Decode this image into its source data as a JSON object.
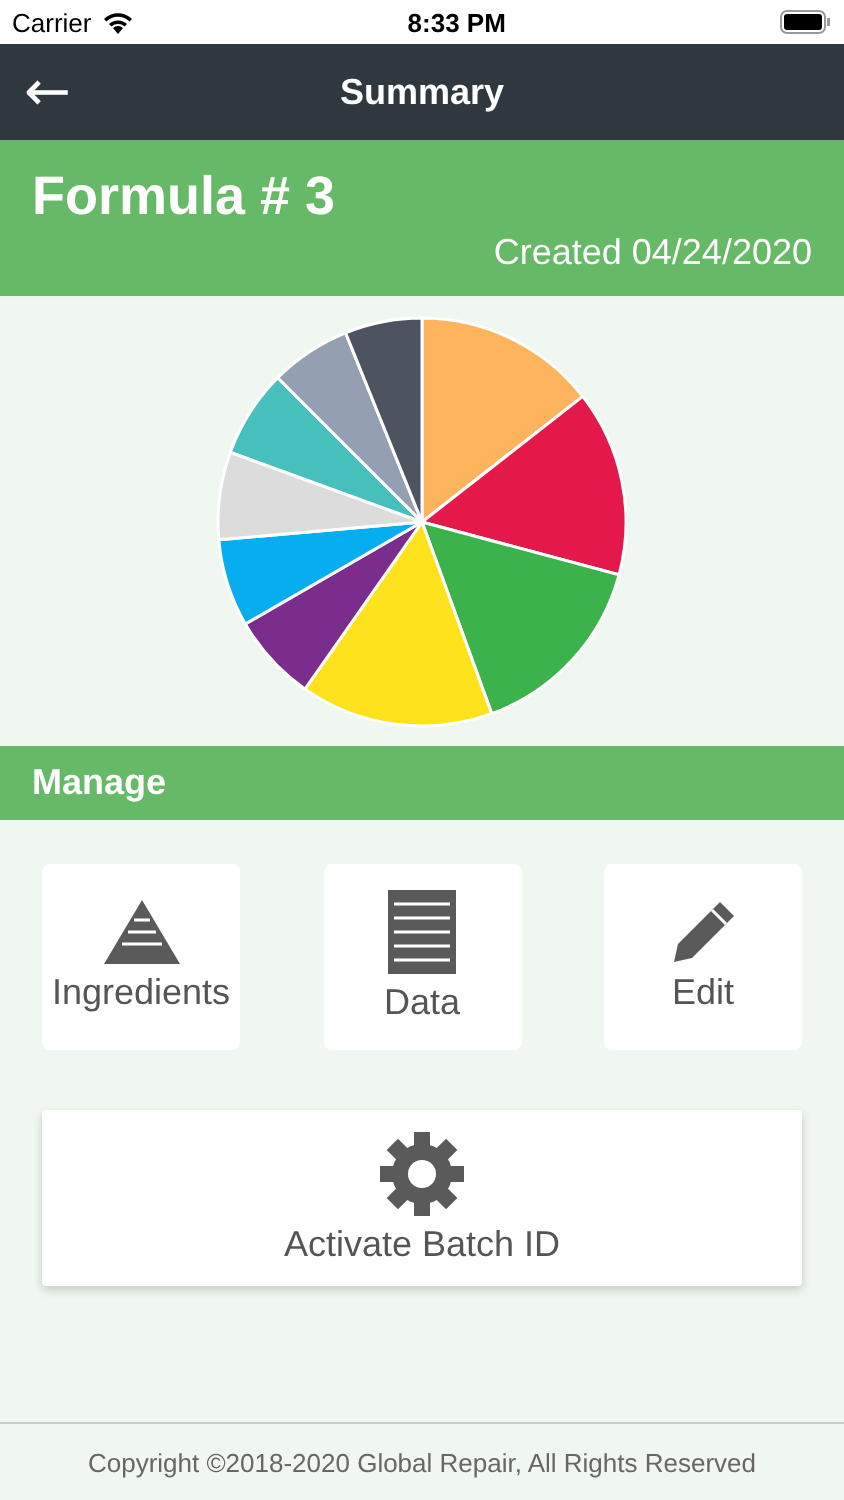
{
  "status_bar": {
    "carrier": "Carrier",
    "time": "8:33 PM"
  },
  "nav_bar": {
    "back_icon": "←",
    "title": "Summary"
  },
  "header": {
    "title": "Formula # 3",
    "created": "Created 04/24/2020"
  },
  "section": {
    "title": "Manage"
  },
  "actions": [
    {
      "label": "Ingredients"
    },
    {
      "label": "Data"
    },
    {
      "label": "Edit"
    }
  ],
  "wide_action": {
    "label": "Activate Batch ID"
  },
  "footer": {
    "copyright": "Copyright ©2018-2020 Global Repair, All Rights Reserved"
  }
}
